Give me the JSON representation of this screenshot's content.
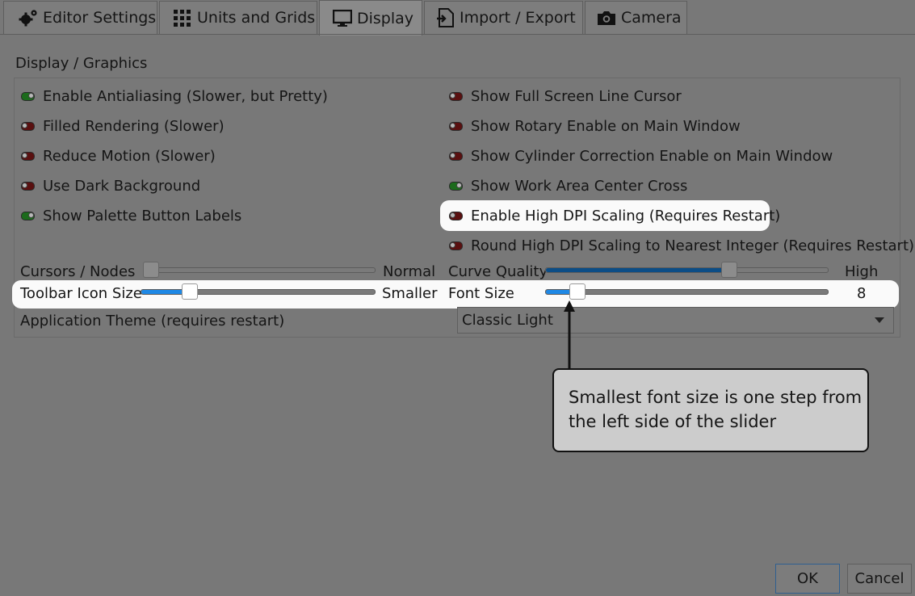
{
  "tabs": [
    {
      "label": "Editor Settings",
      "icon": "gears-icon"
    },
    {
      "label": "Units and Grids",
      "icon": "grid-icon"
    },
    {
      "label": "Display",
      "icon": "monitor-icon",
      "active": true
    },
    {
      "label": "Import / Export",
      "icon": "import-export-icon"
    },
    {
      "label": "Camera",
      "icon": "camera-icon"
    }
  ],
  "group_title": "Display / Graphics",
  "left_options": [
    {
      "label": "Enable Antialiasing (Slower, but Pretty)",
      "checked": true
    },
    {
      "label": "Filled Rendering (Slower)",
      "checked": false
    },
    {
      "label": "Reduce Motion (Slower)",
      "checked": false
    },
    {
      "label": "Use Dark Background",
      "checked": false
    },
    {
      "label": "Show Palette Button Labels",
      "checked": true
    }
  ],
  "right_options": [
    {
      "label": "Show Full Screen Line Cursor",
      "checked": false
    },
    {
      "label": "Show Rotary Enable on Main Window",
      "checked": false
    },
    {
      "label": "Show Cylinder Correction Enable on Main Window",
      "checked": false
    },
    {
      "label": "Show Work Area Center Cross",
      "checked": true
    },
    {
      "label": "Enable High DPI Scaling (Requires Restart)",
      "checked": false,
      "highlighted": true
    },
    {
      "label": "Round High DPI Scaling to Nearest Integer (Requires Restart)",
      "checked": false
    }
  ],
  "sliders": {
    "cursors_nodes": {
      "label": "Cursors / Nodes",
      "end_label": "Normal",
      "level": 0.0
    },
    "toolbar_icon_size": {
      "label": "Toolbar Icon Size",
      "end_label": "Smaller",
      "level": 0.19
    },
    "curve_quality": {
      "label": "Curve Quality",
      "end_label": "High",
      "level": 0.66
    },
    "font_size": {
      "label": "Font Size",
      "value": "8",
      "level": 0.09
    }
  },
  "theme": {
    "label": "Application Theme (requires restart)",
    "value": "Classic Light"
  },
  "callout": {
    "text": "Smallest font size is one step from the left side of the slider"
  },
  "buttons": {
    "ok": "OK",
    "cancel": "Cancel"
  },
  "colors": {
    "toggle_on": "#1c6b1c",
    "toggle_off": "#5a1010",
    "slider_fill": "#1e88e5",
    "highlight": "#fafafa"
  }
}
